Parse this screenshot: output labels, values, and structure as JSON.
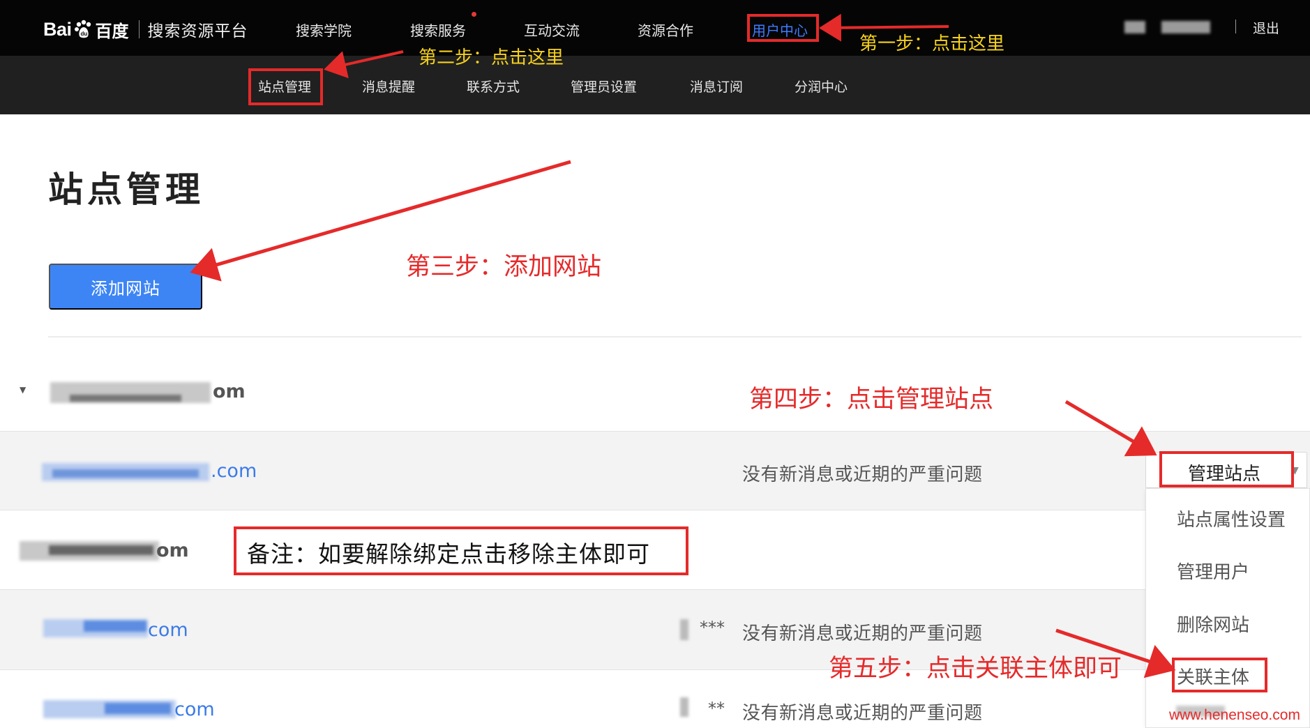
{
  "header": {
    "logo_en": "Bai",
    "logo_cn": "百度",
    "platform": "搜索资源平台",
    "nav": [
      {
        "label": "搜索学院"
      },
      {
        "label": "搜索服务"
      },
      {
        "label": "互动交流"
      },
      {
        "label": "资源合作"
      },
      {
        "label": "用户中心"
      }
    ],
    "logout": "退出"
  },
  "subnav": [
    {
      "label": "站点管理"
    },
    {
      "label": "消息提醒"
    },
    {
      "label": "联系方式"
    },
    {
      "label": "管理员设置"
    },
    {
      "label": "消息订阅"
    },
    {
      "label": "分润中心"
    }
  ],
  "main": {
    "page_title": "站点管理",
    "add_button": "添加网站"
  },
  "sites": [
    {
      "domain_tail": "om",
      "status": "",
      "stars": ""
    },
    {
      "domain_tail": ".com",
      "status": "没有新消息或近期的严重问题",
      "stars": ""
    },
    {
      "domain_tail": "om",
      "status": "",
      "stars": ""
    },
    {
      "domain_tail": "com",
      "status": "没有新消息或近期的严重问题",
      "stars": "***"
    },
    {
      "domain_tail": "com",
      "status": "没有新消息或近期的严重问题",
      "stars": "**"
    }
  ],
  "dropdown": {
    "button": "管理站点",
    "items": [
      {
        "label": "站点属性设置"
      },
      {
        "label": "管理用户"
      },
      {
        "label": "删除网站"
      },
      {
        "label": "关联主体"
      }
    ]
  },
  "annotations": {
    "step1": "第一步：点击这里",
    "step2": "第二步：点击这里",
    "step3": "第三步：添加网站",
    "step4": "第四步：点击管理站点",
    "step5": "第五步：点击关联主体即可",
    "note": "备注：如要解除绑定点击移除主体即可",
    "watermark": "www.henenseo.com"
  },
  "colors": {
    "nav_bg": "#050505",
    "subnav_bg": "#202020",
    "primary_button": "#3d85f5",
    "link_blue": "#3b7be8",
    "annotation_red": "#e52a2a",
    "annotation_yellow": "#f6d21c"
  }
}
